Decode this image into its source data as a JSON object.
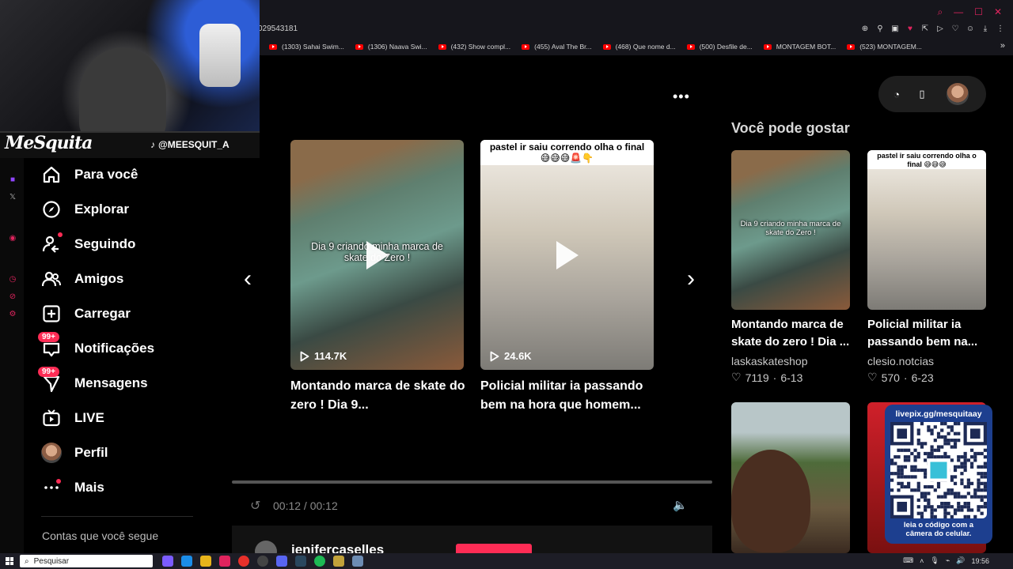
{
  "browser": {
    "url_fragment": "029543181",
    "bookmarks": [
      {
        "label": "(1303) Sahai Swim..."
      },
      {
        "label": "(1306) Naava Swi..."
      },
      {
        "label": "(432) Show compl..."
      },
      {
        "label": "(455) Aval The Br..."
      },
      {
        "label": "(468) Que nome d..."
      },
      {
        "label": "(500) Desfile de..."
      },
      {
        "label": "MONTAGEM BOT..."
      },
      {
        "label": "(523) MONTAGEM..."
      }
    ]
  },
  "stream_overlay": {
    "brand": "MeSquita",
    "handle": "@MEESQUIT_A"
  },
  "sidebar": {
    "items": [
      {
        "label": "Para você",
        "icon": "home-icon"
      },
      {
        "label": "Explorar",
        "icon": "compass-icon"
      },
      {
        "label": "Seguindo",
        "icon": "following-icon"
      },
      {
        "label": "Amigos",
        "icon": "friends-icon"
      },
      {
        "label": "Carregar",
        "icon": "upload-icon"
      },
      {
        "label": "Notificações",
        "icon": "inbox-icon",
        "badge": "99+"
      },
      {
        "label": "Mensagens",
        "icon": "messages-icon",
        "badge": "99+"
      },
      {
        "label": "LIVE",
        "icon": "live-icon"
      },
      {
        "label": "Perfil",
        "icon": "avatar"
      },
      {
        "label": "Mais",
        "icon": "more-icon"
      }
    ],
    "following_header": "Contas que você segue"
  },
  "main": {
    "videos": [
      {
        "overlay": "Dia 9 criando minha marca de skate do Zero !",
        "views": "114.7K",
        "title_line1": "Montando marca de skate do",
        "title_line2": "zero ! Dia 9..."
      },
      {
        "overlay": "pastel ir saiu correndo olha o final 😅😅😅🚨👇",
        "views": "24.6K",
        "title_line1": "Policial militar ia passando",
        "title_line2": "bem na hora que homem..."
      }
    ],
    "player": {
      "time": "00:12 / 00:12",
      "progress_fraction": 0.0
    },
    "comment_user": "jeniferсaselles"
  },
  "recommendations": {
    "title": "Você pode gostar",
    "items": [
      {
        "overlay": "Dia 9 criando minha marca de skate do Zero !",
        "title_line1": "Montando marca de",
        "title_line2": "skate do zero ! Dia ...",
        "author": "laskaskateshop",
        "likes": "7119",
        "date": "6-13"
      },
      {
        "overlay": "pastel ir saiu correndo olha o final 😅😅😅",
        "title_line1": "Policial militar ia",
        "title_line2": "passando bem na...",
        "author": "clesio.notcias",
        "likes": "570",
        "date": "6-23"
      }
    ]
  },
  "qr_overlay": {
    "url": "livepix.gg/mesquitaay",
    "caption_line1": "leia o código com a",
    "caption_line2": "câmera do celular."
  },
  "taskbar": {
    "search_placeholder": "Pesquisar",
    "clock": "19:56"
  },
  "colors": {
    "accent": "#fe2c55",
    "background": "#000000",
    "qr_background": "#1d3f8f"
  }
}
